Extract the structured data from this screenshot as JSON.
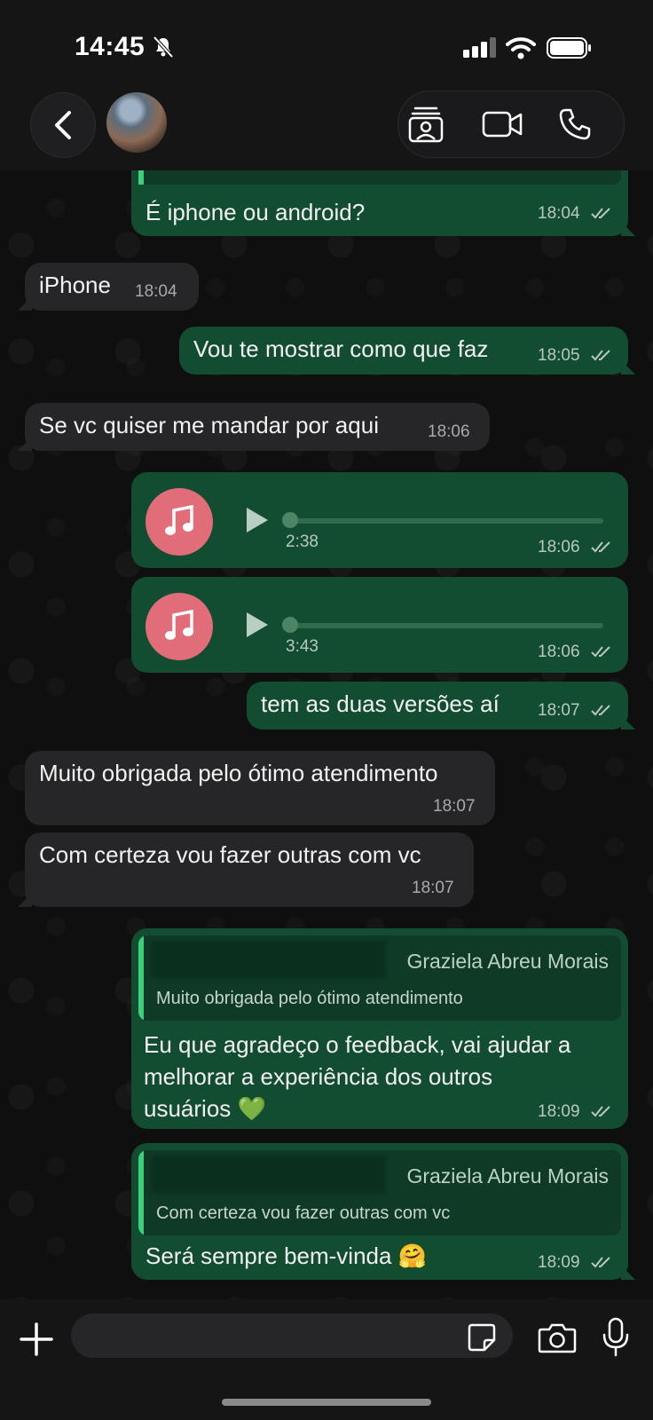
{
  "status_bar": {
    "time": "14:45"
  },
  "header": {},
  "messages": [
    {
      "side": "out",
      "text": "É iphone ou android?",
      "time": "18:04"
    },
    {
      "side": "in",
      "text": "iPhone",
      "time": "18:04"
    },
    {
      "side": "out",
      "text": "Vou te mostrar como que faz",
      "time": "18:05"
    },
    {
      "side": "in",
      "text": "Se vc quiser me mandar por aqui",
      "time": "18:06"
    },
    {
      "side": "out",
      "type": "audio",
      "duration": "2:38",
      "time": "18:06"
    },
    {
      "side": "out",
      "type": "audio",
      "duration": "3:43",
      "time": "18:06"
    },
    {
      "side": "out",
      "text": "tem as duas versões aí",
      "time": "18:07"
    },
    {
      "side": "in",
      "text": "Muito obrigada pelo ótimo atendimento",
      "time": "18:07"
    },
    {
      "side": "in",
      "text": "Com certeza vou fazer outras com vc",
      "time": "18:07"
    },
    {
      "side": "out",
      "reply_to": {
        "name": "Graziela Abreu Morais",
        "text": "Muito obrigada pelo ótimo atendimento"
      },
      "lines": [
        "Eu que agradeço o feedback, vai ajudar a",
        "melhorar a experiência dos outros",
        "usuários 💚"
      ],
      "time": "18:09"
    },
    {
      "side": "out",
      "reply_to": {
        "name": "Graziela Abreu Morais",
        "text": "Com certeza vou fazer outras com vc"
      },
      "text": "Será sempre bem-vinda 🤗",
      "time": "18:09"
    }
  ],
  "input": {
    "placeholder": ""
  },
  "colors": {
    "outgoing_bubble": "#124d32",
    "incoming_bubble": "#262628",
    "accent": "#3fcf7a",
    "audio_icon": "#e06d78"
  }
}
